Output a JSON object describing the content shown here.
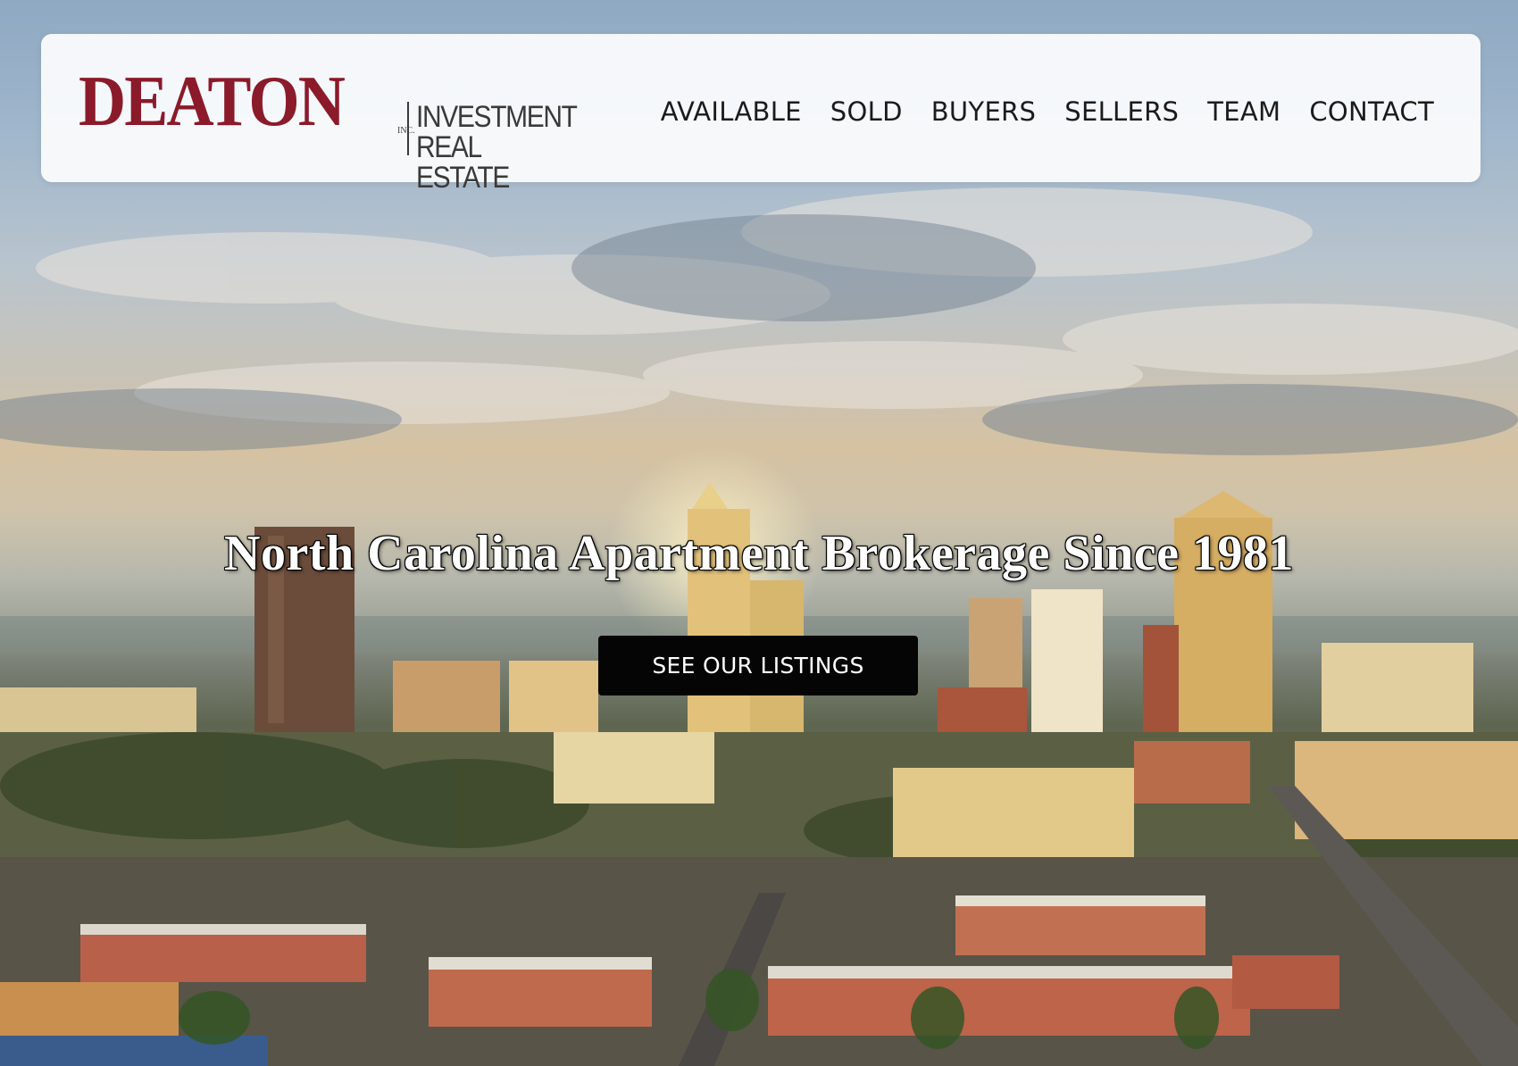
{
  "brand": {
    "name": "DEATON",
    "inc": "INC.",
    "sub_line1": "INVESTMENT",
    "sub_line2": "REAL ESTATE",
    "name_color": "#8b1a2b",
    "sub_color": "#3a3a3a"
  },
  "nav": {
    "items": [
      {
        "label": "AVAILABLE"
      },
      {
        "label": "SOLD"
      },
      {
        "label": "BUYERS"
      },
      {
        "label": "SELLERS"
      },
      {
        "label": "TEAM"
      },
      {
        "label": "CONTACT"
      }
    ]
  },
  "hero": {
    "headline": "North Carolina Apartment Brokerage Since 1981",
    "cta_label": "SEE OUR LISTINGS",
    "background_image": "city-skyline-aerial-photo"
  }
}
